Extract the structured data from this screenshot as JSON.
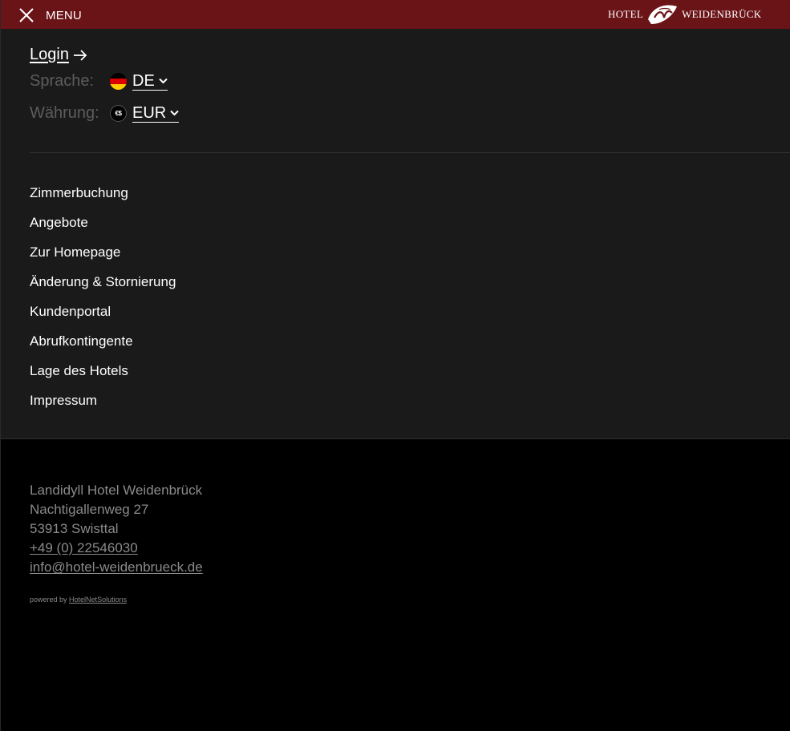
{
  "header": {
    "menu_label": "MENU",
    "logo_left": "HOTEL",
    "logo_right": "WEIDENBRÜCK",
    "bg_color": "#6b1418"
  },
  "account": {
    "login_label": "Login"
  },
  "language": {
    "label": "Sprache:",
    "value": "DE",
    "icon": "germany-flag-icon"
  },
  "currency": {
    "label": "Währung:",
    "value": "EUR",
    "icon": "currency-icon",
    "icon_text": "€$"
  },
  "nav": {
    "items": [
      {
        "label": "Zimmerbuchung"
      },
      {
        "label": "Angebote"
      },
      {
        "label": "Zur Homepage"
      },
      {
        "label": "Änderung & Stornierung"
      },
      {
        "label": "Kundenportal"
      },
      {
        "label": "Abrufkontingente"
      },
      {
        "label": "Lage des Hotels"
      },
      {
        "label": "Impressum"
      }
    ]
  },
  "footer": {
    "name": "Landidyll Hotel Weidenbrück",
    "street": "Nachtigallenweg 27",
    "city": "53913 Swisttal",
    "phone": "+49 (0) 22546030",
    "email": "info@hotel-weidenbrueck.de",
    "powered_prefix": "powered by",
    "powered_link": "HotelNetSolutions"
  }
}
